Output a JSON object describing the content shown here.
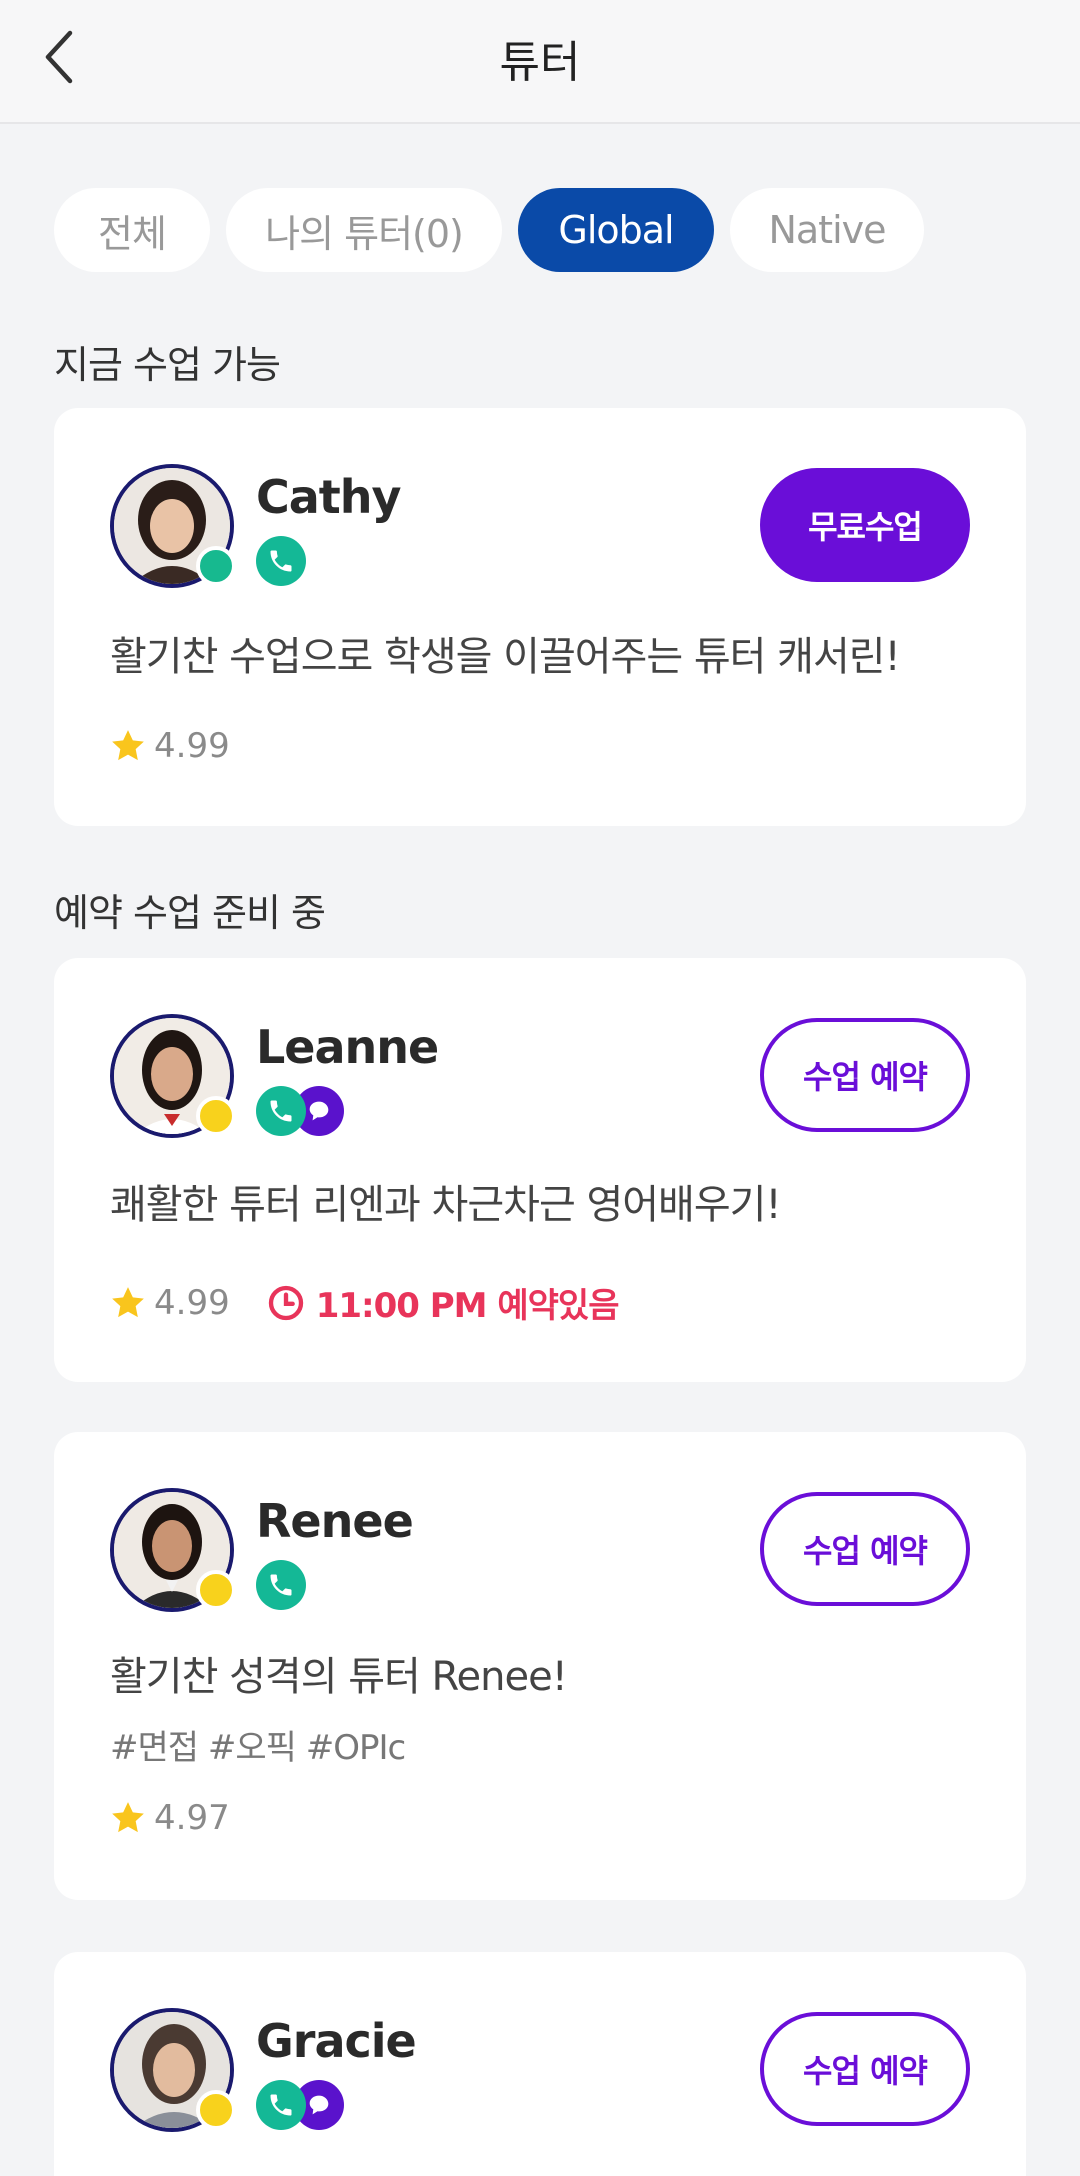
{
  "header": {
    "title": "튜터"
  },
  "tabs": [
    {
      "label": "전체",
      "active": false
    },
    {
      "label": "나의 튜터(0)",
      "active": false
    },
    {
      "label": "Global",
      "active": true
    },
    {
      "label": "Native",
      "active": false
    }
  ],
  "sections": {
    "available_now": "지금 수업 가능",
    "preparing": "예약 수업 준비 중"
  },
  "tutors": [
    {
      "name": "Cathy",
      "description": "활기찬 수업으로 학생을 이끌어주는 튜터 캐서린!",
      "rating": "4.99",
      "cta": "무료수업",
      "status_color": "#17b98f",
      "badges": [
        "phone-icon"
      ]
    },
    {
      "name": "Leanne",
      "description": "쾌활한 튜터 리엔과 차근차근 영어배우기!",
      "rating": "4.99",
      "reservation": "11:00 PM 예약있음",
      "cta": "수업 예약",
      "status_color": "#f8d21c",
      "badges": [
        "phone-icon",
        "chat-icon"
      ]
    },
    {
      "name": "Renee",
      "description": "활기찬 성격의 튜터 Renee!",
      "tags": "#면접 #오픽 #OPIc",
      "rating": "4.97",
      "cta": "수업 예약",
      "status_color": "#f8d21c",
      "badges": [
        "phone-icon"
      ]
    },
    {
      "name": "Gracie",
      "cta": "수업 예약",
      "status_color": "#f8d21c",
      "badges": [
        "phone-icon",
        "chat-icon"
      ]
    }
  ],
  "colors": {
    "accent_blue": "#0a4aa8",
    "accent_purple": "#6a0ed8",
    "phone_badge": "#14b896",
    "reservation_red": "#e8345a",
    "star": "#f9c51d"
  }
}
